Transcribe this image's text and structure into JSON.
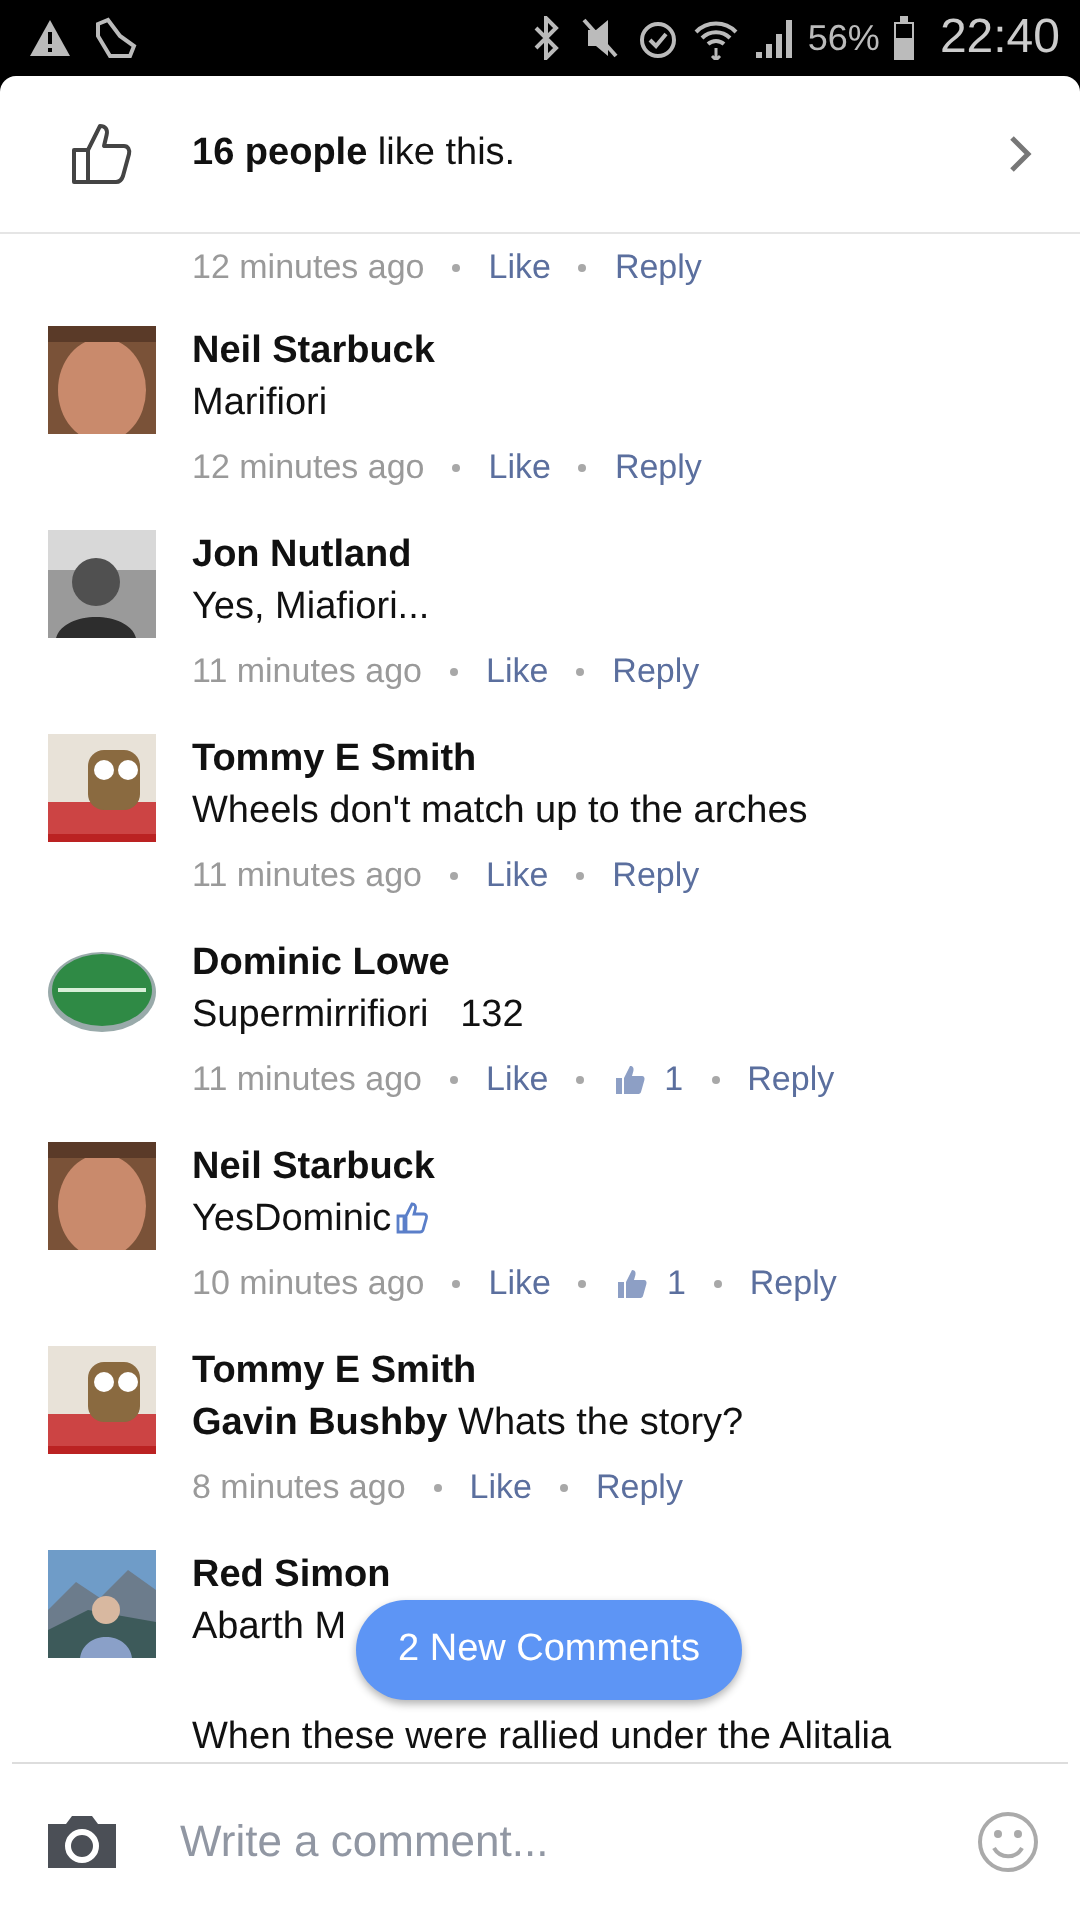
{
  "status_bar": {
    "battery": "56%",
    "time": "22:40"
  },
  "likes_header": {
    "text": "**16 people** like this."
  },
  "top_meta": {
    "time": "12 minutes ago",
    "like": "Like",
    "reply": "Reply"
  },
  "comments": [
    {
      "author": "Neil Starbuck",
      "text": "Marifiori",
      "time": "12 minutes ago",
      "like": "Like",
      "reply": "Reply"
    },
    {
      "author": "Jon Nutland",
      "text": "Yes, Miafiori...",
      "time": "11 minutes ago",
      "like": "Like",
      "reply": "Reply"
    },
    {
      "author": "Tommy E Smith",
      "text": "Wheels don't match up to the arches",
      "time": "11 minutes ago",
      "like": "Like",
      "reply": "Reply"
    },
    {
      "author": "Dominic Lowe",
      "text": "Supermirrifiori   132",
      "time": "11 minutes ago",
      "like": "Like",
      "like_count": "1",
      "reply": "Reply"
    },
    {
      "author": "Neil Starbuck",
      "text": "YesDominic",
      "thumb_emoji": true,
      "time": "10 minutes ago",
      "like": "Like",
      "like_count": "1",
      "reply": "Reply"
    },
    {
      "author": "Tommy E Smith",
      "text": "**Gavin Bushby** Whats the story?",
      "time": "8 minutes ago",
      "like": "Like",
      "reply": "Reply"
    },
    {
      "author": "Red Simon",
      "text": "Abarth M",
      "text_2": "When these were rallied under the Alitalia"
    }
  ],
  "new_comments_button": "2 New Comments",
  "composer": {
    "placeholder": "Write a comment..."
  }
}
